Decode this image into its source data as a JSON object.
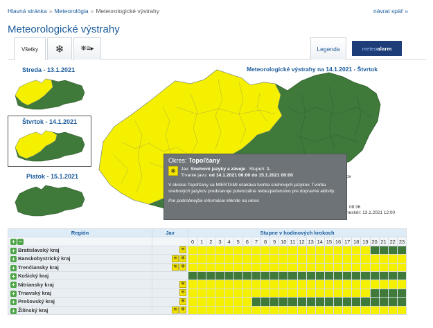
{
  "breadcrumb": {
    "items": [
      "Hlavná stránka",
      "Meteorológia",
      "Meteorologické výstrahy"
    ],
    "separator": "»"
  },
  "back_link": "návrat späť »",
  "page_title": "Meteorologické výstrahy",
  "tabs": {
    "all": "Všetky",
    "snow_icon": "snowflake-icon",
    "drift_icon": "snow-drift-icon",
    "legend": "Legenda"
  },
  "meteoalarm": {
    "brand": "meteo",
    "brand_bold": "alarm"
  },
  "days": [
    {
      "label": "Streda - 13.1.2021"
    },
    {
      "label": "Štvrtok - 14.1.2021"
    },
    {
      "label": "Piatok - 15.1.2021"
    }
  ],
  "map_title": "Meteorologické výstrahy na 14.1.2021 - Štvrtok",
  "side_info": {
    "line1": "ov",
    "line2": "08:36",
    "line3": "neskôr: 13.1.2021 12:00"
  },
  "popup": {
    "title_label": "Okres:",
    "title_value": "Topoľčany",
    "jav_label": "Jav:",
    "jav_value": "Snehové jazyky a záveje",
    "stupen_label": "Stupeň:",
    "stupen_value": "1.",
    "trvanie_label": "Trvanie javu:",
    "trvanie_value": "od 14.1.2021 06:00 do 15.1.2021 00:00",
    "description": "V okrese Topoľčany sa MIESTAMI očakáva tvorba snehových jazykov. Tvorba snehových jazykov predstavuje potenciálne nebezpečenstvo pre dopravné aktivity.",
    "more_link": "Pre podrobnejšie informácie kliknite na okres"
  },
  "table": {
    "headers": {
      "region": "Región",
      "jav": "Jav",
      "hours": "Stupne v hodinových krokoch"
    },
    "hours": [
      "0",
      "1",
      "2",
      "3",
      "4",
      "5",
      "6",
      "7",
      "8",
      "9",
      "10",
      "11",
      "12",
      "13",
      "14",
      "15",
      "16",
      "17",
      "18",
      "19",
      "20",
      "21",
      "22",
      "23"
    ],
    "rows": [
      {
        "name": "Bratislavský kraj",
        "icons": [
          "drift"
        ],
        "levels": "yyyyyyyyyyyyyyyyyyyygggg"
      },
      {
        "name": "Banskobystrický kraj",
        "icons": [
          "drift",
          "snow"
        ],
        "levels": "yyyyyyyyyyyyyyyyyyyyyyyy"
      },
      {
        "name": "Trenčiansky kraj",
        "icons": [
          "drift",
          "snow"
        ],
        "levels": "yyyyyyyyyyyyyyyyyyyyyyyy"
      },
      {
        "name": "Košický kraj",
        "icons": [],
        "levels": "gggggggggggggggggggggggg"
      },
      {
        "name": "Nitriansky kraj",
        "icons": [
          "drift"
        ],
        "levels": "yyyyyyyyyyyyyyyyyyyyyyyy"
      },
      {
        "name": "Trnavský kraj",
        "icons": [
          "drift"
        ],
        "levels": "yyyyyyyyyyyyyyyyyyyygggg"
      },
      {
        "name": "Prešovský kraj",
        "icons": [
          "snow"
        ],
        "levels": "yyyyyyyggggggggggggggggg"
      },
      {
        "name": "Žilinský kraj",
        "icons": [
          "drift",
          "snow"
        ],
        "levels": "yyyyyyyyyyyyyyyyyyyyyyyy"
      }
    ]
  },
  "colors": {
    "yellow": "#f5f000",
    "green": "#3f7a3a",
    "title": "#1a5a9a"
  }
}
